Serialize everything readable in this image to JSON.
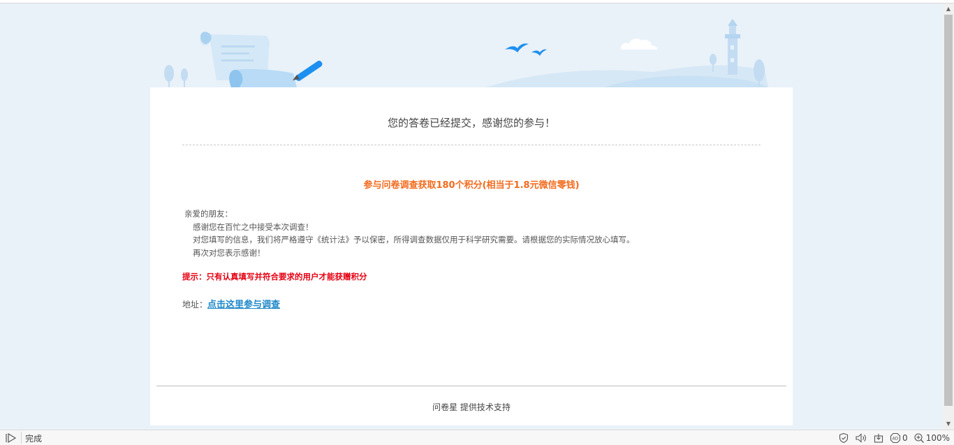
{
  "confirmation": {
    "title": "您的答卷已经提交，感谢您的参与！",
    "headline": "参与问卷调查获取180个积分(相当于1.8元微信零钱)",
    "greeting": "亲爱的朋友：",
    "lines": [
      "感谢您在百忙之中接受本次调查！",
      "对您填写的信息，我们将严格遵守《统计法》予以保密，所得调查数据仅用于科学研究需要。请根据您的实际情况放心填写。",
      "再次对您表示感谢！"
    ],
    "tip": "提示：只有认真填写并符合要求的用户才能获赠积分",
    "address_label": "地址：",
    "address_link": "点击这里参与调查",
    "footer": "问卷星 提供技术支持"
  },
  "statusbar": {
    "status": "完成",
    "blocked_count": "0",
    "zoom": "100%"
  },
  "colors": {
    "background": "#e9f1f9",
    "headline": "#f26b1d",
    "tip": "#e60012",
    "link": "#1e88c9"
  }
}
